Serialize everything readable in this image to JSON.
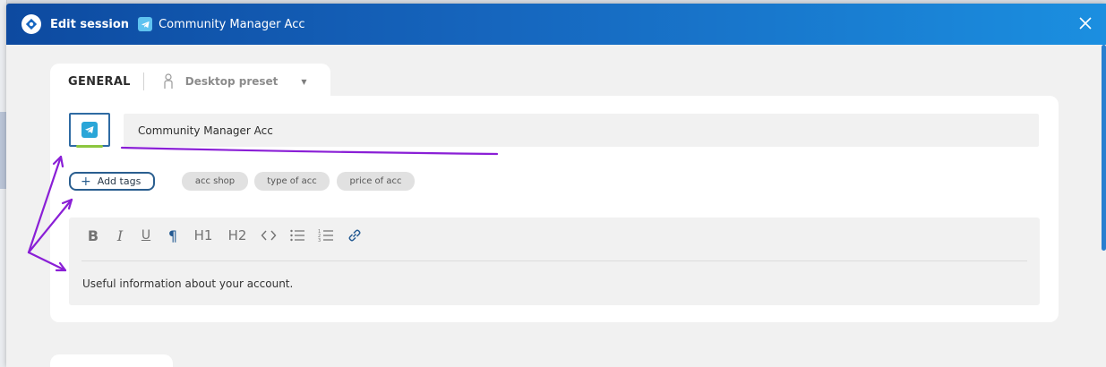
{
  "window": {
    "title": "Edit session",
    "session_name": "Community Manager Acc"
  },
  "tabs": {
    "general_label": "GENERAL",
    "preset_label": "Desktop preset"
  },
  "form": {
    "name_value": "Community Manager Acc",
    "add_tags_label": "Add tags",
    "tags": [
      "acc shop",
      "type of acc",
      "price of acc"
    ]
  },
  "editor": {
    "toolbar": {
      "bold": "B",
      "italic": "I",
      "underline": "U",
      "paragraph": "¶",
      "h1": "H1",
      "h2": "H2"
    },
    "content": "Useful information about your account."
  },
  "colors": {
    "titlebar_start": "#0d4aa0",
    "titlebar_end": "#1b8fe0",
    "status_green": "#8cc63f",
    "annotation_purple": "#8a1fd6",
    "telegram_blue": "#2aa6d8"
  }
}
